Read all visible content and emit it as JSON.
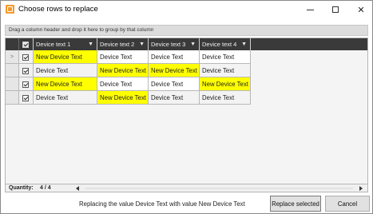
{
  "window": {
    "title": "Choose rows to replace"
  },
  "group_panel": {
    "hint": "Drag a column header and drop it here to group by that column"
  },
  "grid": {
    "columns": [
      {
        "label": "Device text 1"
      },
      {
        "label": "Device text 2"
      },
      {
        "label": "Device text 3"
      },
      {
        "label": "Device text 4"
      }
    ],
    "rows": [
      {
        "current": true,
        "checked": true,
        "cells": [
          {
            "text": "New Device Text",
            "highlighted": true
          },
          {
            "text": "Device Text",
            "highlighted": false
          },
          {
            "text": "Device Text",
            "highlighted": false
          },
          {
            "text": "Device Text",
            "highlighted": false
          }
        ]
      },
      {
        "current": false,
        "checked": true,
        "cells": [
          {
            "text": "Device Text",
            "highlighted": false
          },
          {
            "text": "New Device Text",
            "highlighted": true
          },
          {
            "text": "New Device Text",
            "highlighted": true
          },
          {
            "text": "Device Text",
            "highlighted": false
          }
        ]
      },
      {
        "current": false,
        "checked": true,
        "cells": [
          {
            "text": "New Device Text",
            "highlighted": true
          },
          {
            "text": "Device Text",
            "highlighted": false
          },
          {
            "text": "Device Text",
            "highlighted": false
          },
          {
            "text": "New Device Text",
            "highlighted": true
          }
        ]
      },
      {
        "current": false,
        "checked": true,
        "cells": [
          {
            "text": "Device Text",
            "highlighted": false
          },
          {
            "text": "New Device Text",
            "highlighted": true
          },
          {
            "text": "Device Text",
            "highlighted": false
          },
          {
            "text": "Device Text",
            "highlighted": false
          }
        ]
      }
    ],
    "current_row_marker": ">",
    "highlight_color": "#ffff00",
    "header_color": "#3a3a3a"
  },
  "status": {
    "quantity_label": "Quantity:",
    "quantity_value": "4 / 4"
  },
  "footer": {
    "message": "Replacing the value Device Text with value New Device Text",
    "replace_label": "Replace selected",
    "cancel_label": "Cancel"
  },
  "icons": {
    "app": "app-icon",
    "minimize": "minimize-icon",
    "maximize": "maximize-icon",
    "close": "close-icon",
    "filter": "filter-icon"
  }
}
